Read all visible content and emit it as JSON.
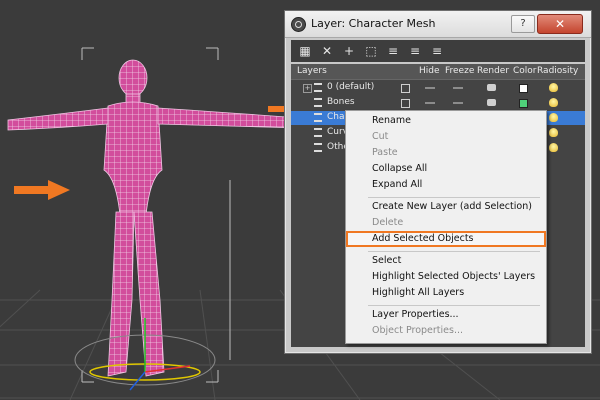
{
  "dialog": {
    "title": "Layer: Character Mesh",
    "help_label": "?",
    "close_label": "✕"
  },
  "toolbar": {
    "icons": [
      "layer-manager-icon",
      "delete-icon",
      "add-icon",
      "select-objects-icon",
      "highlight-icon",
      "hide-icon",
      "freeze-icon"
    ],
    "glyphs": [
      "▦",
      "✕",
      "+",
      "⬚",
      "≡",
      "≡",
      "≡"
    ]
  },
  "layers_panel": {
    "columns": {
      "layers": "Layers",
      "hide": "Hide",
      "freeze": "Freeze",
      "render": "Render",
      "color": "Color",
      "radiosity": "Radiosity"
    },
    "rows": [
      {
        "name": "0 (default)",
        "expand": "+",
        "color": "#ffffff",
        "selected": false
      },
      {
        "name": "Bones",
        "expand": "",
        "color": "#4fd07a",
        "selected": false
      },
      {
        "name": "Character Mesh",
        "expand": "",
        "color": "#d8d8d8",
        "selected": true
      },
      {
        "name": "Curve",
        "expand": "",
        "color": "#d8d8d8",
        "selected": false
      },
      {
        "name": "Other",
        "expand": "",
        "color": "#d8d8d8",
        "selected": false
      }
    ]
  },
  "context_menu": {
    "rename": "Rename",
    "cut": "Cut",
    "paste": "Paste",
    "collapse_all": "Collapse All",
    "expand_all": "Expand All",
    "create_new_layer": "Create New Layer (add Selection)",
    "delete": "Delete",
    "add_selected_objects": "Add Selected Objects",
    "select": "Select",
    "highlight_selected": "Highlight Selected Objects' Layers",
    "highlight_all": "Highlight All Layers",
    "layer_properties": "Layer Properties...",
    "object_properties": "Object Properties..."
  },
  "colors": {
    "accent_orange": "#f07822",
    "mesh_pink": "#d94aa0",
    "selection_blue": "#3a7bd5"
  }
}
